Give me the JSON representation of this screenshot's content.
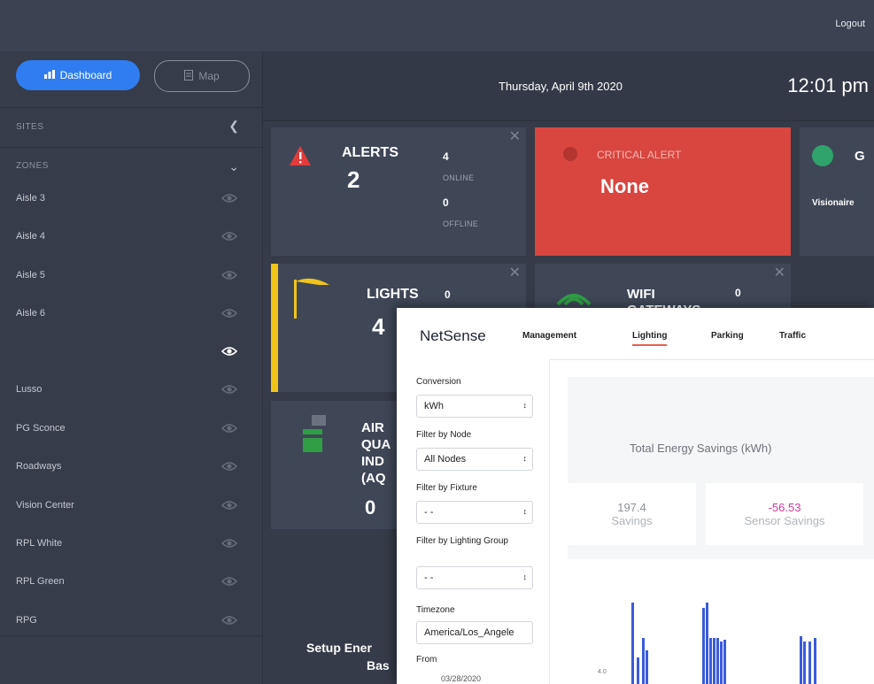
{
  "topbar": {
    "logout": "Logout"
  },
  "sidebar": {
    "dashboard_label": "Dashboard",
    "map_label": "Map",
    "sites_label": "SITES",
    "zones_label": "ZONES",
    "zones": [
      {
        "label": "Aisle 3"
      },
      {
        "label": "Aisle 4"
      },
      {
        "label": "Aisle 5"
      },
      {
        "label": "Aisle 6"
      },
      {
        "label": ""
      },
      {
        "label": "Lusso"
      },
      {
        "label": "PG Sconce"
      },
      {
        "label": "Roadways"
      },
      {
        "label": "Vision Center"
      },
      {
        "label": "RPL White"
      },
      {
        "label": "RPL Green"
      },
      {
        "label": "RPG"
      }
    ]
  },
  "header": {
    "date": "Thursday, April 9th 2020",
    "time": "12:01 pm"
  },
  "cards": {
    "alerts": {
      "title": "ALERTS",
      "count": "2",
      "online_count": "4",
      "online_label": "ONLINE",
      "offline_count": "0",
      "offline_label": "OFFLINE"
    },
    "critical": {
      "title": "CRITICAL ALERT",
      "value": "None"
    },
    "gateway": {
      "title": "G",
      "subtitle": "Visionaire"
    },
    "lights": {
      "title": "LIGHTS",
      "count": "4",
      "side_count": "0"
    },
    "wifi": {
      "title": "WIFI",
      "title2": "GATEWAYS",
      "count": "0"
    },
    "aqi": {
      "line1": "AIR",
      "line2": "QUA",
      "line3": "IND",
      "line4": "(AQ",
      "value": "0"
    },
    "setup": {
      "line1": "Setup Ener",
      "line2": "Bas"
    }
  },
  "colors": {
    "accent": "#2f7df0",
    "critical": "#d9453f",
    "lights": "#f0c419",
    "aqi": "#2f9e44",
    "bars": "#3b5bdb",
    "active_tab": "#e8604c"
  },
  "overlay": {
    "brand": "NetSense",
    "nav": [
      "Management",
      "Lighting",
      "Parking",
      "Traffic"
    ],
    "filters": {
      "conversion_label": "Conversion",
      "conversion_value": "kWh",
      "node_label": "Filter by Node",
      "node_value": "All Nodes",
      "fixture_label": "Filter by Fixture",
      "fixture_value": "- -",
      "group_label": "Filter by Lighting Group",
      "group_value": "- -",
      "timezone_label": "Timezone",
      "timezone_value": "America/Los_Angele",
      "from_label": "From",
      "from_value": "03/28/2020"
    },
    "chart_title": "Total Energy Savings (kWh)",
    "stats": [
      {
        "value": "197.4",
        "label": "Savings"
      },
      {
        "value": "-56.53",
        "label": "Sensor Savings"
      }
    ],
    "axis_tick": "4.0"
  }
}
